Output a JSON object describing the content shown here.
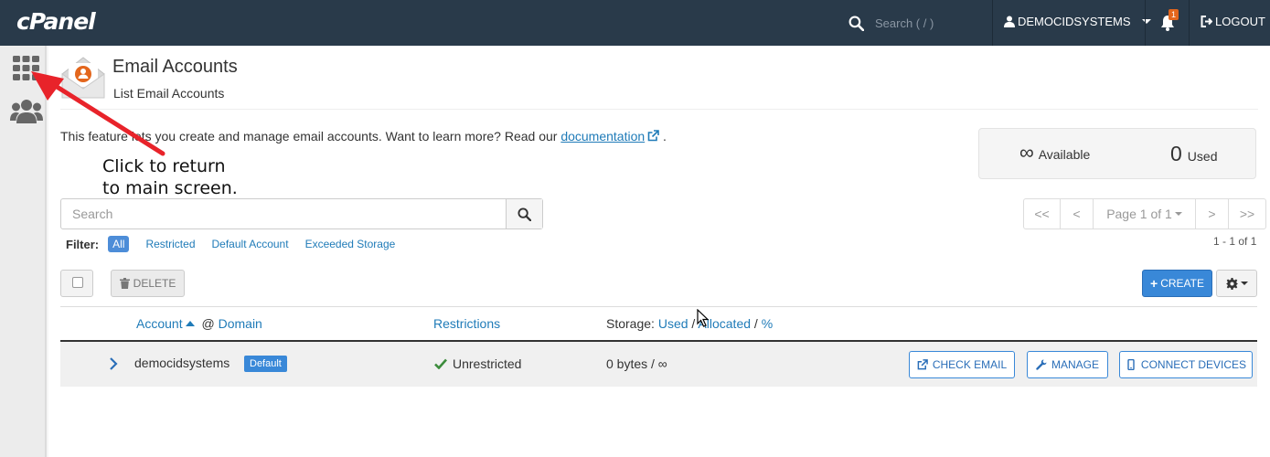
{
  "topbar": {
    "logo": "cPanel",
    "search_placeholder": "Search ( / )",
    "username": "DEMOCIDSYSTEMS",
    "notification_count": "1",
    "logout": "LOGOUT"
  },
  "page": {
    "title": "Email Accounts",
    "subtitle": "List Email Accounts",
    "intro": "This feature lets you create and manage email accounts. Want to learn more? Read our ",
    "doc_link": "documentation",
    "intro_end": " ."
  },
  "stats": {
    "available_value": "∞",
    "available_label": "Available",
    "used_value": "0",
    "used_label": "Used"
  },
  "annotation": {
    "line1": "Click to return",
    "line2": "to main screen."
  },
  "search": {
    "placeholder": "Search"
  },
  "filter": {
    "label": "Filter:",
    "options": [
      "All",
      "Restricted",
      "Default Account",
      "Exceeded Storage"
    ],
    "active": "All"
  },
  "pager": {
    "first": "<<",
    "prev": "<",
    "page": "Page 1 of 1",
    "next": ">",
    "last": ">>",
    "range": "1 - 1 of 1"
  },
  "toolbar": {
    "delete": "DELETE",
    "create": "CREATE"
  },
  "table": {
    "col_account": "Account",
    "col_at": " @ ",
    "col_domain": "Domain",
    "col_restrictions": "Restrictions",
    "col_storage": "Storage:",
    "col_used": "Used",
    "col_sep1": " / ",
    "col_allocated": "Allocated",
    "col_sep2": " / ",
    "col_percent": "%",
    "rows": [
      {
        "account": "democidsystems",
        "tag": "Default",
        "restriction": "Unrestricted",
        "storage": "0 bytes / ∞",
        "check_email": "CHECK EMAIL",
        "manage": "MANAGE",
        "connect": "CONNECT DEVICES"
      }
    ]
  },
  "colors": {
    "topbar": "#293a4a",
    "accent": "#3988d8",
    "link": "#1f7bb8",
    "brand_orange": "#e3661c",
    "arrow": "#e8232a"
  }
}
